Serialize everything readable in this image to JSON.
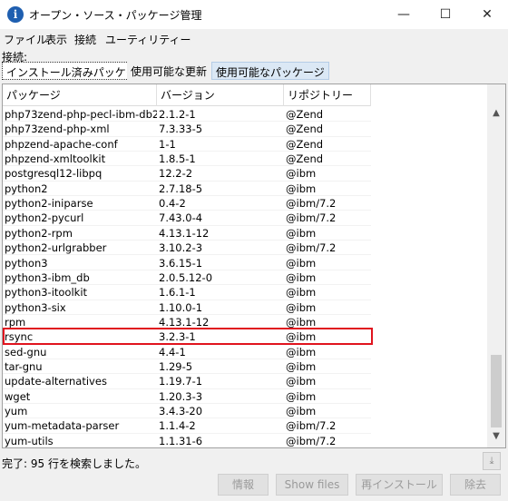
{
  "window": {
    "title": "オープン・ソース・パッケージ管理",
    "app_icon_letter": "i",
    "min_glyph": "—",
    "max_glyph": "☐",
    "close_glyph": "✕"
  },
  "menu": [
    "ファイル",
    "表示",
    "接続",
    "ユーティリティー"
  ],
  "connection_label": "接続:",
  "tabs": [
    "インストール済みパッケージ",
    "使用可能な更新",
    "使用可能なパッケージ"
  ],
  "table": {
    "headers": [
      "パッケージ",
      "バージョン",
      "リポジトリー"
    ],
    "rows": [
      [
        "php73zend-php-pecl-ibm-db2",
        "2.1.2-1",
        "@Zend"
      ],
      [
        "php73zend-php-xml",
        "7.3.33-5",
        "@Zend"
      ],
      [
        "phpzend-apache-conf",
        "1-1",
        "@Zend"
      ],
      [
        "phpzend-xmltoolkit",
        "1.8.5-1",
        "@Zend"
      ],
      [
        "postgresql12-libpq",
        "12.2-2",
        "@ibm"
      ],
      [
        "python2",
        "2.7.18-5",
        "@ibm"
      ],
      [
        "python2-iniparse",
        "0.4-2",
        "@ibm/7.2"
      ],
      [
        "python2-pycurl",
        "7.43.0-4",
        "@ibm/7.2"
      ],
      [
        "python2-rpm",
        "4.13.1-12",
        "@ibm"
      ],
      [
        "python2-urlgrabber",
        "3.10.2-3",
        "@ibm/7.2"
      ],
      [
        "python3",
        "3.6.15-1",
        "@ibm"
      ],
      [
        "python3-ibm_db",
        "2.0.5.12-0",
        "@ibm"
      ],
      [
        "python3-itoolkit",
        "1.6.1-1",
        "@ibm"
      ],
      [
        "python3-six",
        "1.10.0-1",
        "@ibm"
      ],
      [
        "rpm",
        "4.13.1-12",
        "@ibm"
      ],
      [
        "rsync",
        "3.2.3-1",
        "@ibm"
      ],
      [
        "sed-gnu",
        "4.4-1",
        "@ibm"
      ],
      [
        "tar-gnu",
        "1.29-5",
        "@ibm"
      ],
      [
        "update-alternatives",
        "1.19.7-1",
        "@ibm"
      ],
      [
        "wget",
        "1.20.3-3",
        "@ibm"
      ],
      [
        "yum",
        "3.4.3-20",
        "@ibm"
      ],
      [
        "yum-metadata-parser",
        "1.1.4-2",
        "@ibm/7.2"
      ],
      [
        "yum-utils",
        "1.1.31-6",
        "@ibm/7.2"
      ]
    ],
    "highlighted_row": "rsync"
  },
  "status": "完了: 95 行を検索しました。",
  "buttons": [
    "情報",
    "Show files",
    "再インストール",
    "除去"
  ],
  "colors": {
    "highlight": "#e0141e",
    "active_tab": "#dbe8f5"
  }
}
